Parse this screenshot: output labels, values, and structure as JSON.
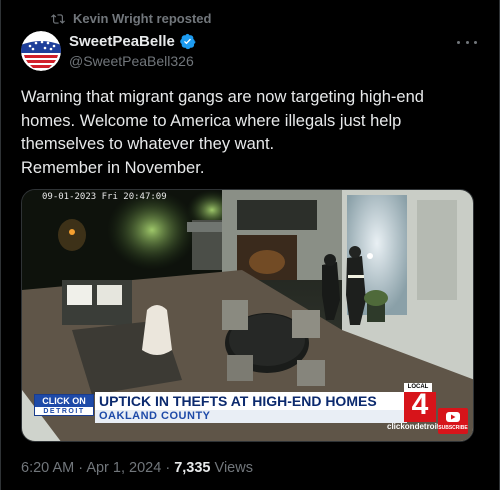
{
  "repost": {
    "label": "Kevin Wright reposted"
  },
  "author": {
    "display_name": "SweetPeaBelle",
    "handle": "@SweetPeaBell326"
  },
  "tweet": {
    "lines": [
      "Warning that migrant gangs are now targeting high-end",
      "homes. Welcome to America where illegals just help",
      "themselves to whatever they want.",
      "Remember in November."
    ]
  },
  "media": {
    "camera_timestamp": "09-01-2023 Fri 20:47:09",
    "station_brand_top": "CLICK ON",
    "station_brand_bottom": "DETROIT",
    "headline": "UPTICK IN THEFTS AT HIGH-END HOMES",
    "subhead": "OAKLAND COUNTY",
    "local_label": "LOCAL",
    "channel_number": "4",
    "website": "clickondetroit.com",
    "subscribe_label": "SUBSCRIBE"
  },
  "meta": {
    "time": "6:20 AM",
    "separator": "·",
    "date": "Apr 1, 2024",
    "views_count": "7,335",
    "views_label": "Views"
  },
  "colors": {
    "background": "#000000",
    "text_primary": "#e7e9ea",
    "text_secondary": "#71767b",
    "verified_blue": "#1d9bf0",
    "news_red": "#d7141a",
    "news_blue": "#1e4aa8"
  },
  "icons": {
    "repost": "repost-icon",
    "verified": "verified-badge-icon",
    "more": "more-options-icon",
    "play": "youtube-play-icon"
  }
}
